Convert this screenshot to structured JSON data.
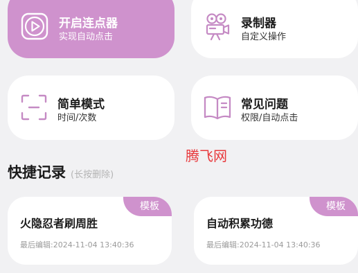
{
  "menu": {
    "start": {
      "title": "开启连点器",
      "subtitle": "实现自动点击",
      "icon": "play-icon"
    },
    "record": {
      "title": "录制器",
      "subtitle": "自定义操作",
      "icon": "camera-icon"
    },
    "simple": {
      "title": "简单模式",
      "subtitle": "时间/次数",
      "icon": "scan-frame-icon"
    },
    "faq": {
      "title": "常见问题",
      "subtitle": "权限/自动点击",
      "icon": "book-icon"
    }
  },
  "watermark": "腾飞网",
  "shortcuts": {
    "title": "快捷记录",
    "hint": "(长按删除)",
    "items": [
      {
        "tag": "模板",
        "name": "火隐忍者刷周胜",
        "edited": "最后编辑:2024-11-04 13:40:36"
      },
      {
        "tag": "模板",
        "name": "自动积累功德",
        "edited": "最后编辑:2024-11-04 13:40:36"
      }
    ]
  },
  "colors": {
    "accent": "#cf92cd",
    "background": "#f1f1f3",
    "card": "#ffffff",
    "watermark": "#e8383b"
  }
}
